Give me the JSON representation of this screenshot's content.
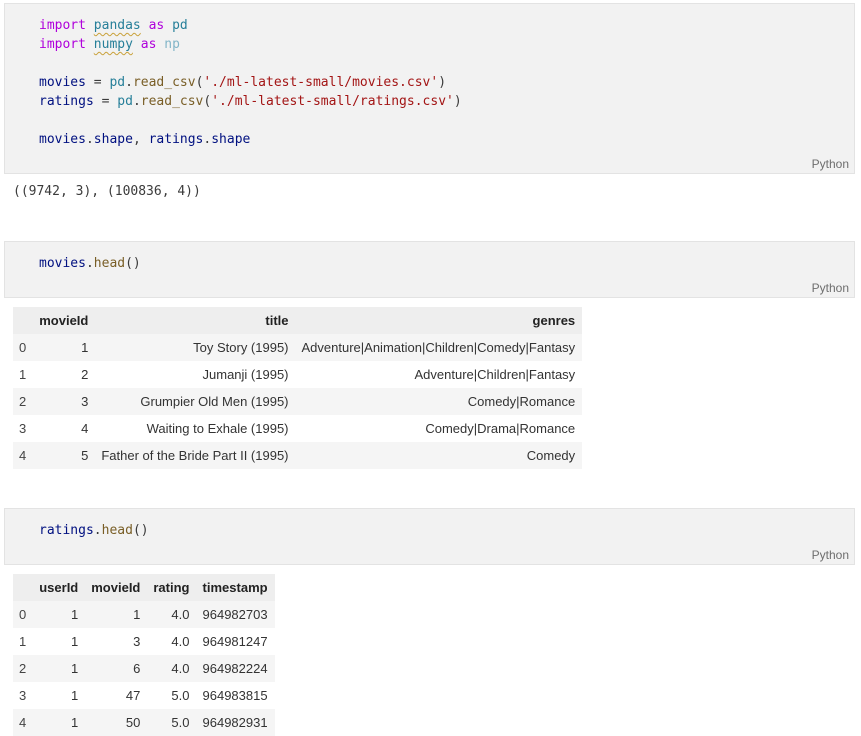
{
  "cells": {
    "cell1": {
      "lines": [
        [
          {
            "t": "import",
            "c": "kw"
          },
          {
            "t": " "
          },
          {
            "t": "pandas",
            "c": "mod squig"
          },
          {
            "t": " "
          },
          {
            "t": "as",
            "c": "kw"
          },
          {
            "t": " "
          },
          {
            "t": "pd",
            "c": "mod"
          }
        ],
        [
          {
            "t": "import",
            "c": "kw"
          },
          {
            "t": " "
          },
          {
            "t": "numpy",
            "c": "mod squig"
          },
          {
            "t": " "
          },
          {
            "t": "as",
            "c": "kw"
          },
          {
            "t": " "
          },
          {
            "t": "np",
            "c": "alias-dim"
          }
        ],
        [],
        [
          {
            "t": "movies",
            "c": "var"
          },
          {
            "t": " = "
          },
          {
            "t": "pd",
            "c": "mod"
          },
          {
            "t": "."
          },
          {
            "t": "read_csv",
            "c": "fn"
          },
          {
            "t": "("
          },
          {
            "t": "'./ml-latest-small/movies.csv'",
            "c": "str"
          },
          {
            "t": ")"
          }
        ],
        [
          {
            "t": "ratings",
            "c": "var"
          },
          {
            "t": " = "
          },
          {
            "t": "pd",
            "c": "mod"
          },
          {
            "t": "."
          },
          {
            "t": "read_csv",
            "c": "fn"
          },
          {
            "t": "("
          },
          {
            "t": "'./ml-latest-small/ratings.csv'",
            "c": "str"
          },
          {
            "t": ")"
          }
        ],
        [],
        [
          {
            "t": "movies",
            "c": "var"
          },
          {
            "t": "."
          },
          {
            "t": "shape",
            "c": "var"
          },
          {
            "t": ", "
          },
          {
            "t": "ratings",
            "c": "var"
          },
          {
            "t": "."
          },
          {
            "t": "shape",
            "c": "var"
          }
        ]
      ],
      "language": "Python",
      "output": "((9742, 3), (100836, 4))"
    },
    "cell2": {
      "lines": [
        [
          {
            "t": "movies",
            "c": "var"
          },
          {
            "t": "."
          },
          {
            "t": "head",
            "c": "fn"
          },
          {
            "t": "()"
          }
        ]
      ],
      "language": "Python"
    },
    "cell3": {
      "lines": [
        [
          {
            "t": "ratings",
            "c": "var"
          },
          {
            "t": "."
          },
          {
            "t": "head",
            "c": "fn"
          },
          {
            "t": "()"
          }
        ]
      ],
      "language": "Python"
    }
  },
  "movies_table": {
    "columns": [
      "",
      "movieId",
      "title",
      "genres"
    ],
    "rows": [
      [
        "0",
        "1",
        "Toy Story (1995)",
        "Adventure|Animation|Children|Comedy|Fantasy"
      ],
      [
        "1",
        "2",
        "Jumanji (1995)",
        "Adventure|Children|Fantasy"
      ],
      [
        "2",
        "3",
        "Grumpier Old Men (1995)",
        "Comedy|Romance"
      ],
      [
        "3",
        "4",
        "Waiting to Exhale (1995)",
        "Comedy|Drama|Romance"
      ],
      [
        "4",
        "5",
        "Father of the Bride Part II (1995)",
        "Comedy"
      ]
    ]
  },
  "ratings_table": {
    "columns": [
      "",
      "userId",
      "movieId",
      "rating",
      "timestamp"
    ],
    "rows": [
      [
        "0",
        "1",
        "1",
        "4.0",
        "964982703"
      ],
      [
        "1",
        "1",
        "3",
        "4.0",
        "964981247"
      ],
      [
        "2",
        "1",
        "6",
        "4.0",
        "964982224"
      ],
      [
        "3",
        "1",
        "47",
        "5.0",
        "964983815"
      ],
      [
        "4",
        "1",
        "50",
        "5.0",
        "964982931"
      ]
    ]
  }
}
